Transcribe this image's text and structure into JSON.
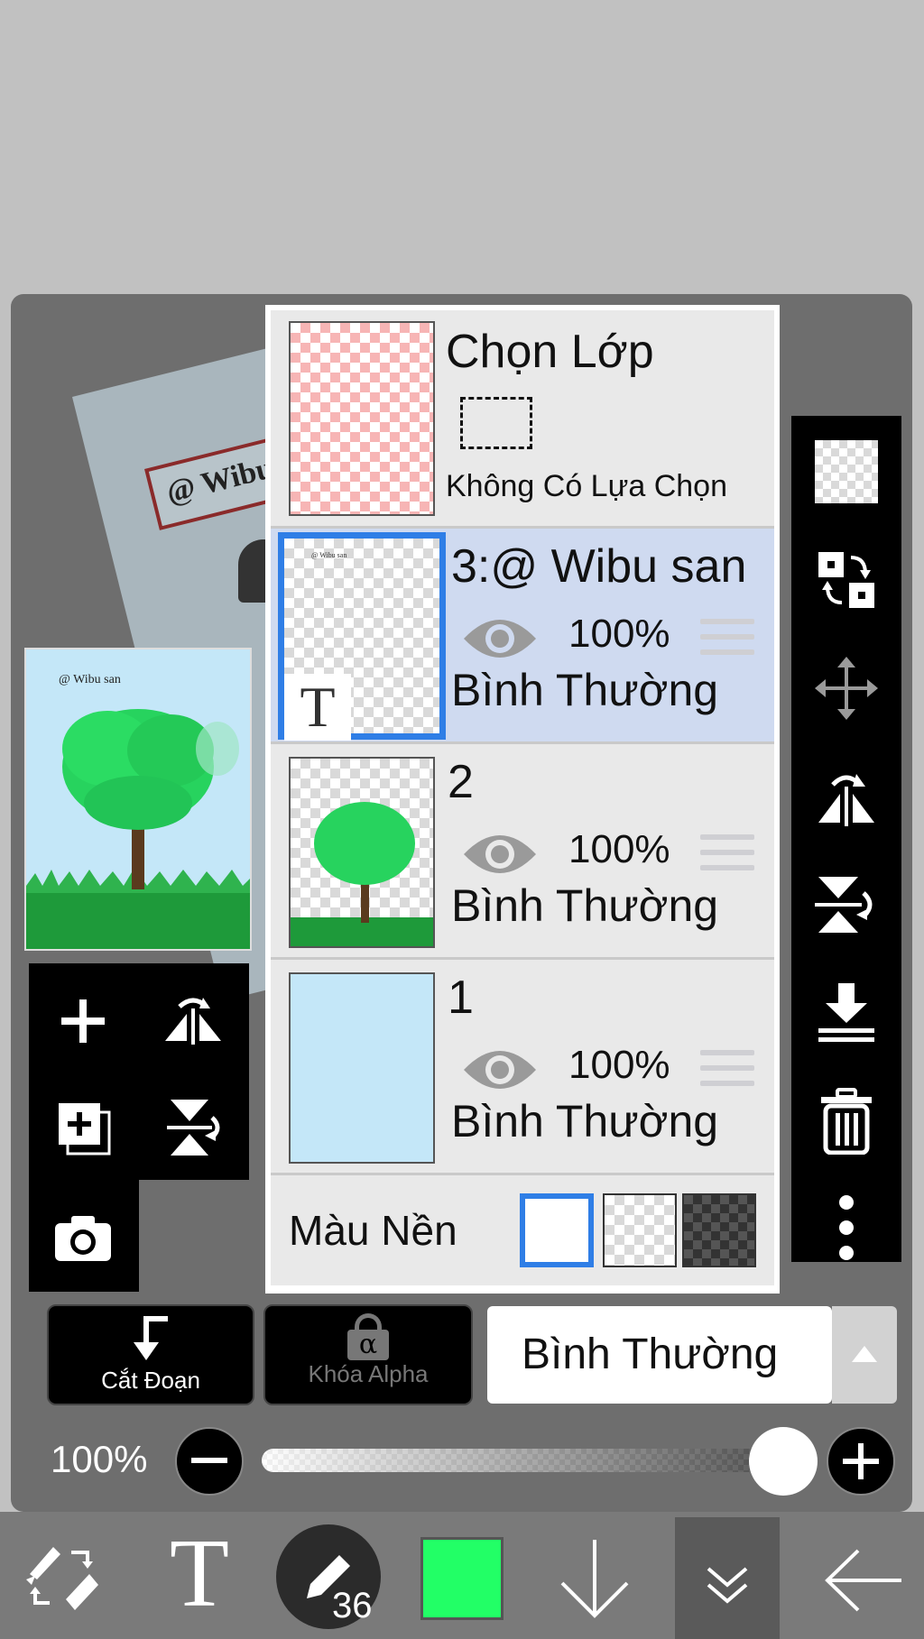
{
  "layers_panel": {
    "selection_layer": {
      "title": "Chọn Lớp",
      "status": "Không Có Lựa Chọn"
    },
    "layers": [
      {
        "name": "3:@ Wibu san",
        "opacity": "100%",
        "blend_mode": "Bình Thường",
        "selected": true,
        "thumb_badge": "T",
        "thumb_text": "@ Wibu san"
      },
      {
        "name": "2",
        "opacity": "100%",
        "blend_mode": "Bình Thường",
        "selected": false
      },
      {
        "name": "1",
        "opacity": "100%",
        "blend_mode": "Bình Thường",
        "selected": false,
        "fill_color": "#c4e7f8"
      }
    ],
    "background_color": {
      "label": "Màu Nền",
      "options": [
        "white",
        "transparent",
        "dark-checker"
      ],
      "selected": "white"
    }
  },
  "canvas": {
    "preview_text": "@ Wibu san",
    "stamp_text": "@ Wibu"
  },
  "layer_controls": {
    "clipping_label": "Cắt Đoạn",
    "alpha_lock_label": "Khóa Alpha",
    "alpha_icon": "α",
    "blend_mode_value": "Bình Thường"
  },
  "opacity": {
    "label": "100%",
    "value": 1.0
  },
  "bottom_toolbar": {
    "brush_size": "36",
    "current_color": "#22ff66"
  },
  "colors": {
    "accent_blue": "#2f7ee6",
    "selected_row": "#cfdaf0",
    "sky_blue": "#c4e7f8",
    "tree_green": "#27d35e"
  }
}
